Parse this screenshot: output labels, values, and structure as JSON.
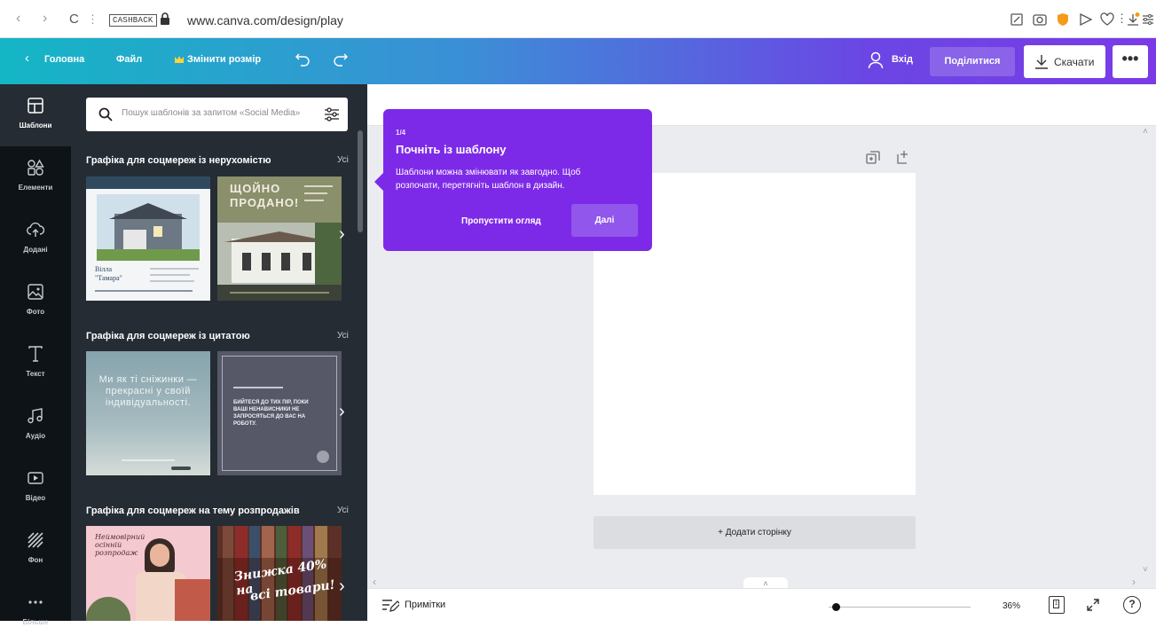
{
  "browser": {
    "back": "‹",
    "forward": "›",
    "reload": "C",
    "cashback": "CASHBACK",
    "url": "www.canva.com/design/play"
  },
  "header": {
    "home": "Головна",
    "file": "Файл",
    "resize": "Змінити розмір",
    "login": "Вхід",
    "share": "Поділитися",
    "download": "Скачати",
    "more": "•••"
  },
  "rail": [
    {
      "label": "Шаблони",
      "icon": "templates-icon"
    },
    {
      "label": "Елементи",
      "icon": "elements-icon"
    },
    {
      "label": "Додані",
      "icon": "uploads-icon"
    },
    {
      "label": "Фото",
      "icon": "photos-icon"
    },
    {
      "label": "Текст",
      "icon": "text-icon"
    },
    {
      "label": "Аудіо",
      "icon": "audio-icon"
    },
    {
      "label": "Відео",
      "icon": "video-icon"
    },
    {
      "label": "Фон",
      "icon": "background-icon"
    },
    {
      "label": "Більше",
      "icon": "more-icon"
    }
  ],
  "panel": {
    "search_placeholder": "Пошук шаблонів за запитом «Social Media»",
    "sections": [
      {
        "title": "Графіка для соцмереж із нерухомістю",
        "all": "Усі",
        "thumbs": [
          {
            "name1": "Вілла",
            "name2": "\"Тамара\""
          },
          {
            "line1": "ЩОЙНО",
            "line2": "ПРОДАНО!"
          }
        ]
      },
      {
        "title": "Графіка для соцмереж із цитатою",
        "all": "Усі",
        "thumbs": [
          {
            "text": "Ми як ті сніжинки — прекрасні у своїй індивідуальності."
          },
          {
            "text": "БИЙТЕСЯ ДО ТИХ ПІР, ПОКИ ВАШІ НЕНАВИСНИКИ НЕ ЗАПРОСЯТЬСЯ ДО ВАС НА РОБОТУ."
          }
        ]
      },
      {
        "title": "Графіка для соцмереж на тему розпродажів",
        "all": "Усі",
        "thumbs": [
          {
            "text": "Неймовірний осінній розпродаж"
          },
          {
            "line1": "Знижка 40% на",
            "line2": "всі товари!"
          }
        ]
      }
    ]
  },
  "popover": {
    "step": "1/4",
    "title": "Почніть із шаблону",
    "body": "Шаблони можна змінювати як завгодно. Щоб розпочати, перетягніть шаблон в дизайн.",
    "skip": "Пропустити огляд",
    "next": "Далі",
    "color": "#7d2ae8"
  },
  "editor": {
    "add_page": "+ Додати сторінку"
  },
  "bottom": {
    "notes": "Примітки",
    "zoom": "36%",
    "page_number": "1",
    "help": "?",
    "zoom_level": 0.05
  }
}
